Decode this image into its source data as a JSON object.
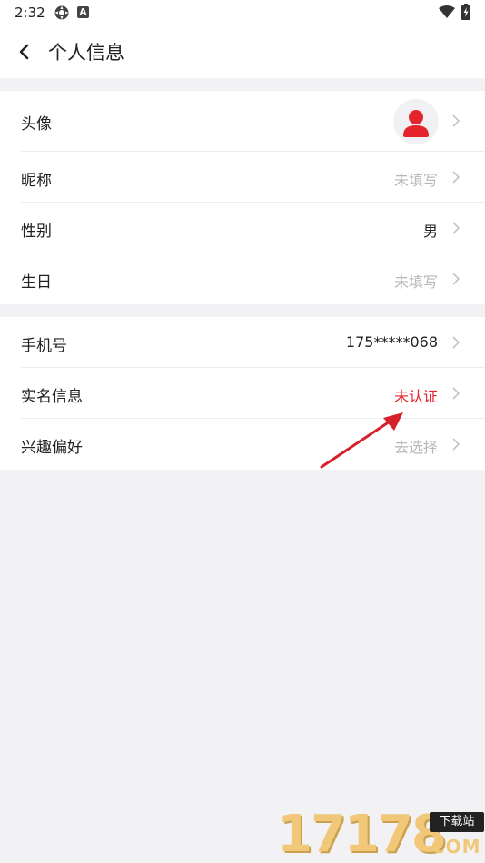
{
  "status_bar": {
    "time": "2:32",
    "icons": [
      "settings-gear-icon",
      "a-badge-icon",
      "wifi-icon",
      "battery-charging-icon"
    ]
  },
  "header": {
    "back_icon": "back-chevron-icon",
    "title": "个人信息"
  },
  "section1": {
    "rows": [
      {
        "label": "头像",
        "value": "",
        "avatar_icon": "user-avatar-icon"
      },
      {
        "label": "昵称",
        "value": "未填写"
      },
      {
        "label": "性别",
        "value": "男"
      },
      {
        "label": "生日",
        "value": "未填写"
      }
    ]
  },
  "section2": {
    "rows": [
      {
        "label": "手机号",
        "value": "175*****068"
      },
      {
        "label": "实名信息",
        "value": "未认证"
      },
      {
        "label": "兴趣偏好",
        "value": "去选择"
      }
    ]
  },
  "colors": {
    "accent_red": "#e3242b",
    "placeholder_gray": "#b8b8b8",
    "page_bg": "#f2f2f4"
  },
  "watermark": {
    "digits": "17178",
    "badge": "下载站",
    "suffix": "COM"
  }
}
